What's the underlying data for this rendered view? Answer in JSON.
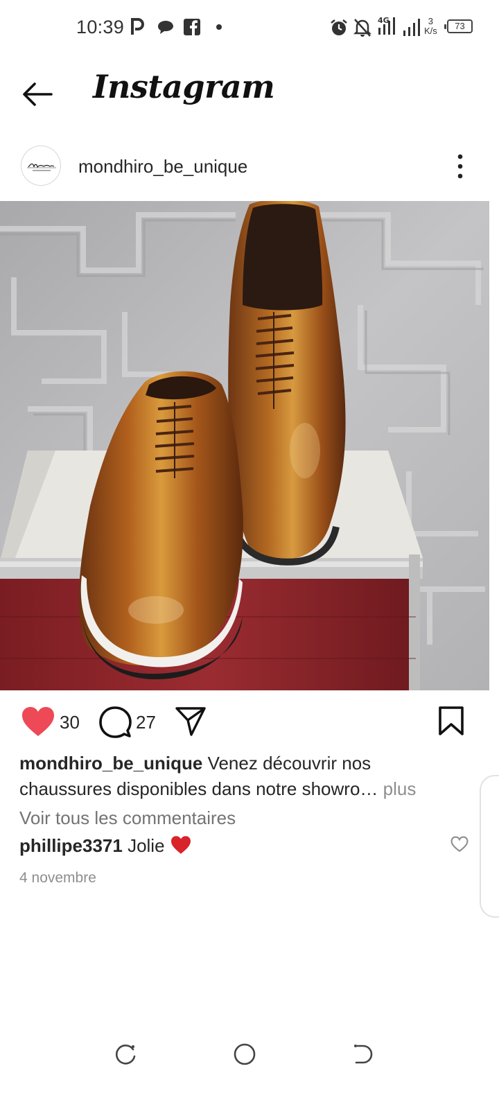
{
  "status_bar": {
    "time": "10:39",
    "network_speed_value": "3",
    "network_speed_unit": "K/s",
    "battery": "73",
    "icons": [
      "parking-icon",
      "message-bubble-icon",
      "facebook-icon",
      "dot-icon",
      "alarm-icon",
      "mute-bell-icon",
      "4g-signal-icon",
      "signal-icon",
      "battery-icon"
    ]
  },
  "header": {
    "title": "Instagram",
    "back_icon": "arrow-left-icon"
  },
  "post": {
    "username": "mondhiro_be_unique",
    "more_icon": "vertical-dots-icon",
    "image_description_icon": "shoe-photo",
    "likes": "30",
    "comments": "27",
    "liked": true,
    "like_color": "#ed4956",
    "caption_username": "mondhiro_be_unique",
    "caption_text": " Venez découvrir nos chaussures disponibles dans notre showro…",
    "caption_more": " plus",
    "view_all_comments": "Voir tous les commentaires",
    "comment_username": "phillipe3371",
    "comment_text": " Jolie ",
    "comment_emoji": "❤️",
    "date": "4 novembre"
  },
  "nav_bar": {
    "icons": [
      "recent-apps-icon",
      "home-circle-icon",
      "back-nav-icon"
    ]
  }
}
